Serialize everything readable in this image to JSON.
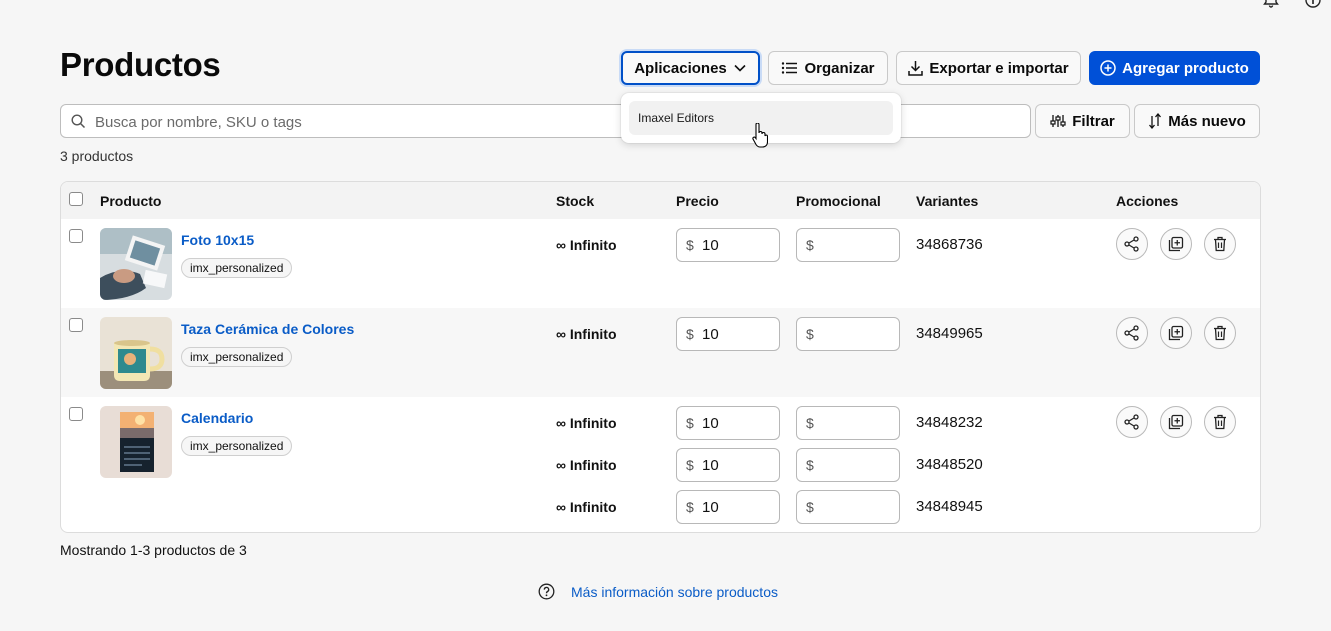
{
  "page": {
    "title": "Productos",
    "count_label": "3 productos",
    "showing_label": "Mostrando 1-3 productos de 3",
    "help_link": "Más información sobre productos"
  },
  "header": {
    "apps_label": "Aplicaciones",
    "organize_label": "Organizar",
    "export_label": "Exportar e importar",
    "add_label": "Agregar producto"
  },
  "search": {
    "placeholder": "Busca por nombre, SKU o tags",
    "value": ""
  },
  "filters": {
    "filter_label": "Filtrar",
    "sort_label": "Más nuevo"
  },
  "dropdown": {
    "items": [
      "Imaxel Editors"
    ]
  },
  "table": {
    "headers": {
      "product": "Producto",
      "stock": "Stock",
      "price": "Precio",
      "promo": "Promocional",
      "variants": "Variantes",
      "actions": "Acciones"
    },
    "currency": "$",
    "rows": [
      {
        "name": "Foto 10x15",
        "tag": "imx_personalized",
        "variants": [
          {
            "stock": "∞ Infinito",
            "price": "10",
            "promo": "",
            "id": "34868736"
          }
        ]
      },
      {
        "name": "Taza Cerámica de Colores",
        "tag": "imx_personalized",
        "variants": [
          {
            "stock": "∞ Infinito",
            "price": "10",
            "promo": "",
            "id": "34849965"
          }
        ]
      },
      {
        "name": "Calendario",
        "tag": "imx_personalized",
        "variants": [
          {
            "stock": "∞ Infinito",
            "price": "10",
            "promo": "",
            "id": "34848232"
          },
          {
            "stock": "∞ Infinito",
            "price": "10",
            "promo": "",
            "id": "34848520"
          },
          {
            "stock": "∞ Infinito",
            "price": "10",
            "promo": "",
            "id": "34848945"
          }
        ]
      }
    ]
  },
  "icons": {
    "apps_chevron": "chevron-down-icon",
    "organize": "list-icon",
    "export": "download-icon",
    "add": "plus-circle-icon",
    "search": "search-icon",
    "filter": "sliders-icon",
    "sort": "sort-arrows-icon",
    "share": "share-icon",
    "duplicate": "duplicate-icon",
    "delete": "trash-icon",
    "help": "question-circle-icon",
    "notifications": "bell-icon",
    "info": "info-icon"
  },
  "colors": {
    "accent": "#0050d7",
    "link": "#0a5cc7",
    "background": "#f6f6f6"
  }
}
